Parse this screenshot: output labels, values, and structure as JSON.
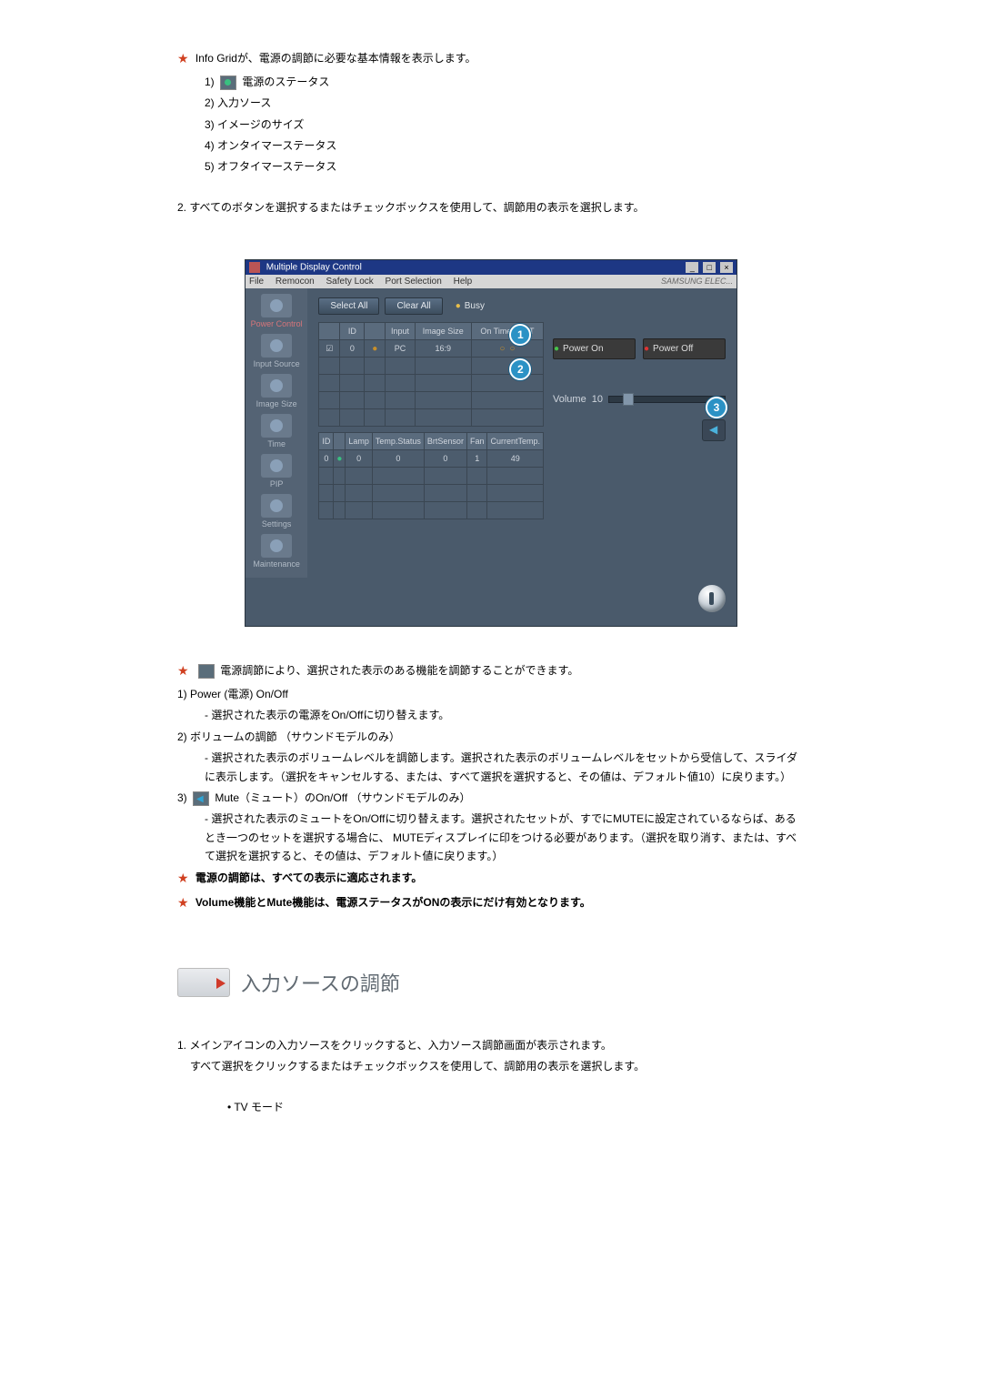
{
  "info_grid": {
    "intro_prefix": "Info Grid",
    "intro_suffix": "が、電源の調節に必要な基本情報を表示します。",
    "items": [
      "電源のステータス",
      "入力ソース",
      "イメージのサイズ",
      "オンタイマーステータス",
      "オフタイマーステータス"
    ]
  },
  "step2": "2. すべてのボタンを選択するまたはチェックボックスを使用して、調節用の表示を選択します。",
  "app": {
    "title": "Multiple Display Control",
    "menus": [
      "File",
      "Remocon",
      "Safety Lock",
      "Port Selection",
      "Help"
    ],
    "brand": "SAMSUNG ELEC...",
    "sidebar": [
      {
        "label": "Power Control"
      },
      {
        "label": "Input Source"
      },
      {
        "label": "Image Size"
      },
      {
        "label": "Time"
      },
      {
        "label": "PIP"
      },
      {
        "label": "Settings"
      },
      {
        "label": "Maintenance"
      }
    ],
    "buttons": {
      "select_all": "Select All",
      "clear_all": "Clear All",
      "busy": "Busy"
    },
    "grid1": {
      "headers": [
        "",
        "ID",
        "",
        "Input",
        "Image Size",
        "On Timer Off T"
      ],
      "row": {
        "id": "0",
        "input": "PC",
        "image_size": "16:9"
      }
    },
    "grid2": {
      "headers": [
        "ID",
        "",
        "Lamp",
        "Temp.Status",
        "BrtSensor",
        "Fan",
        "CurrentTemp."
      ],
      "row": {
        "id": "0",
        "lamp": "0",
        "temp_status": "0",
        "brt": "0",
        "fan": "1",
        "cur": "49"
      }
    },
    "power_on": "Power On",
    "power_off": "Power Off",
    "volume_label": "Volume",
    "volume_value": "10",
    "markers": {
      "m1": "1",
      "m2": "2",
      "m3": "3"
    }
  },
  "desc_intro": "電源調節により、選択された表示のある機能を調節することができます。",
  "desc1": {
    "title": "1) Power (電源) On/Off",
    "body": "- 選択された表示の電源をOn/Offに切り替えます。"
  },
  "desc2": {
    "title": "2) ボリュームの調節 （サウンドモデルのみ）",
    "body": "- 選択された表示のボリュームレベルを調節します。選択された表示のボリュームレベルをセットから受信して、スライダに表示します。（選択をキャンセルする、または、すべて選択を選択すると、その値は、デフォルト値10）に戻ります。）"
  },
  "desc3": {
    "title_before": "3) ",
    "title_after": " Mute（ミュート）のOn/Off （サウンドモデルのみ）",
    "body": "- 選択された表示のミュートをOn/Offに切り替えます。選択されたセットが、すでにMUTEに設定されているならば、あるとき一つのセットを選択する場合に、 MUTEディスプレイに印をつける必要があります。（選択を取り消す、または、すべて選択を選択すると、その値は、デフォルト値に戻ります。）"
  },
  "note1": "電源の調節は、すべての表示に適応されます。",
  "note2": "Volume機能とMute機能は、電源ステータスがONの表示にだけ有効となります。",
  "input_section": {
    "heading": "入力ソースの調節",
    "p1": "1. メインアイコンの入力ソースをクリックすると、入力ソース調節画面が表示されます。",
    "p2": "すべて選択をクリックするまたはチェックボックスを使用して、調節用の表示を選択します。",
    "bullet": "• TV モード"
  },
  "num": {
    "n1": "1) ",
    "n2": "2) ",
    "n3": "3) ",
    "n4": "4) ",
    "n5": "5) "
  }
}
